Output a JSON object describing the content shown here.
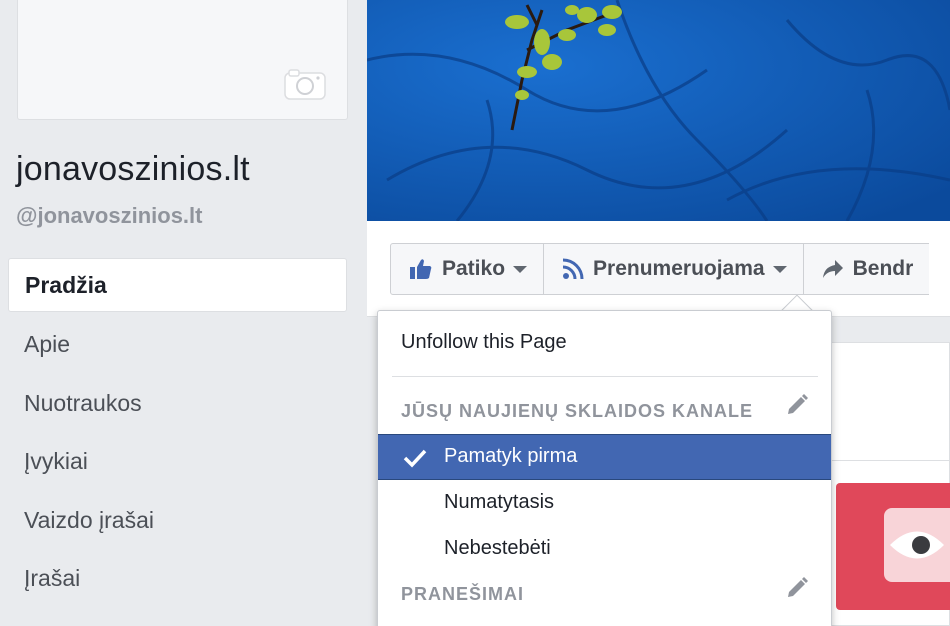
{
  "page": {
    "name": "jonavoszinios.lt",
    "handle": "@jonavoszinios.lt"
  },
  "nav": {
    "items": [
      {
        "label": "Pradžia",
        "active": true
      },
      {
        "label": "Apie"
      },
      {
        "label": "Nuotraukos"
      },
      {
        "label": "Įvykiai"
      },
      {
        "label": "Vaizdo įrašai"
      },
      {
        "label": "Įrašai"
      }
    ]
  },
  "actions": {
    "like_label": "Patiko",
    "follow_label": "Prenumeruojama",
    "share_label": "Bendr"
  },
  "dropdown": {
    "unfollow_label": "Unfollow this Page",
    "feed_heading": "JŪSŲ NAUJIENŲ SKLAIDOS KANALE",
    "options": [
      {
        "label": "Pamatyk pirma",
        "selected": true
      },
      {
        "label": "Numatytasis"
      },
      {
        "label": "Nebestebėti"
      }
    ],
    "notifications_heading": "PRANEŠIMAI"
  },
  "colors": {
    "brand_blue": "#4267b2",
    "background": "#e9ebee",
    "accent_red": "#e0485a"
  },
  "icons": {
    "camera": "camera-icon",
    "like": "thumbs-up-icon",
    "follow": "rss-icon",
    "share": "share-arrow-icon",
    "edit": "pencil-icon",
    "check": "check-icon",
    "eye": "eye-icon"
  }
}
